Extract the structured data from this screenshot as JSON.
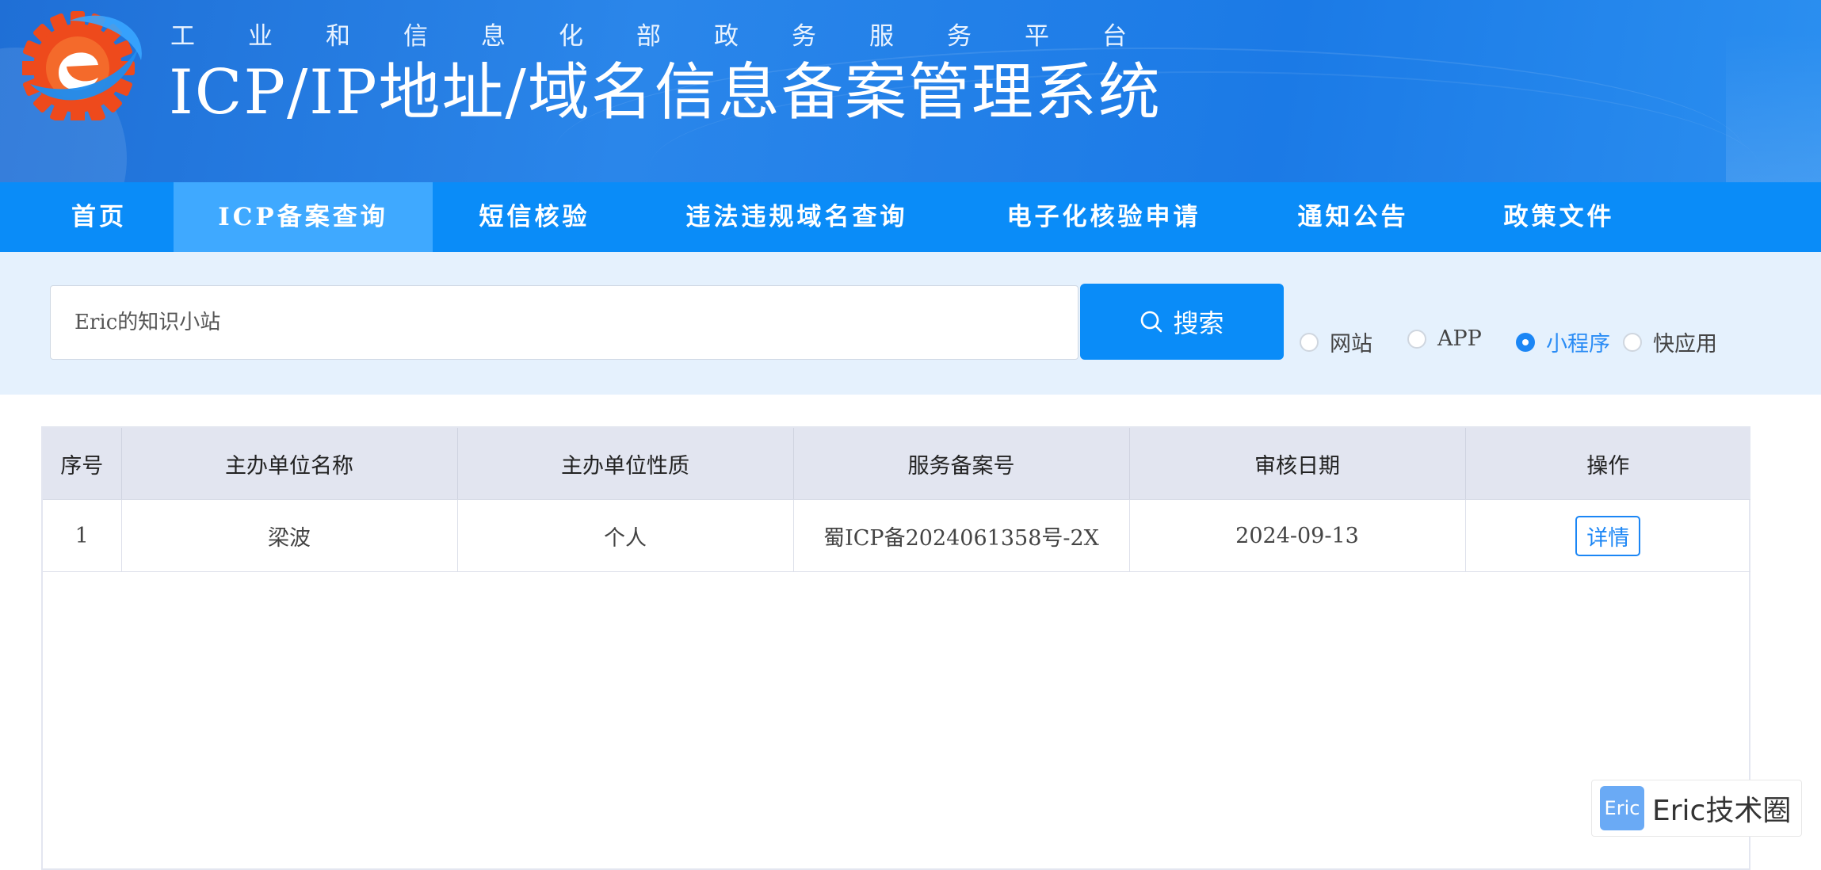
{
  "header": {
    "subtitle": "工业和信息化部政务服务平台",
    "title": "ICP/IP地址/域名信息备案管理系统"
  },
  "nav": {
    "items": [
      {
        "label": "首页",
        "active": false
      },
      {
        "label": "ICP备案查询",
        "active": true
      },
      {
        "label": "短信核验",
        "active": false
      },
      {
        "label": "违法违规域名查询",
        "active": false
      },
      {
        "label": "电子化核验申请",
        "active": false
      },
      {
        "label": "通知公告",
        "active": false
      },
      {
        "label": "政策文件",
        "active": false
      }
    ]
  },
  "search": {
    "value": "Eric的知识小站",
    "button_label": "搜索",
    "types": [
      {
        "label": "网站",
        "checked": false
      },
      {
        "label": "APP",
        "checked": false
      },
      {
        "label": "小程序",
        "checked": true
      },
      {
        "label": "快应用",
        "checked": false
      }
    ]
  },
  "table": {
    "headers": [
      "序号",
      "主办单位名称",
      "主办单位性质",
      "服务备案号",
      "审核日期",
      "操作"
    ],
    "rows": [
      {
        "index": "1",
        "name": "梁波",
        "nature": "个人",
        "record_no": "蜀ICP备2024061358号-2X",
        "date": "2024-09-13",
        "action": "详情"
      }
    ]
  },
  "watermark": {
    "badge": "Eric",
    "text": "Eric技术圈"
  },
  "colors": {
    "nav_bg": "#0a8cf8",
    "nav_active": "#3fa9ff",
    "accent": "#1b86f5",
    "search_band": "#e5f1fd"
  }
}
